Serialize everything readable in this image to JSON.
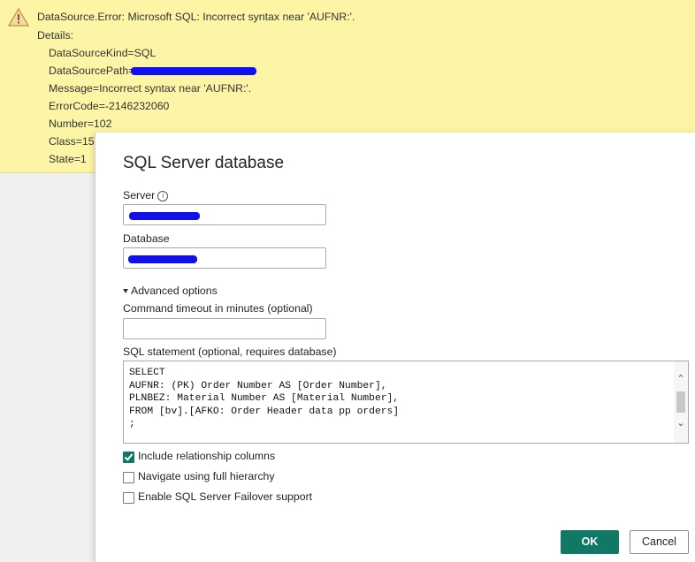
{
  "error": {
    "title": "DataSource.Error: Microsoft SQL: Incorrect syntax near 'AUFNR:'.",
    "details_label": "Details:",
    "source_kind": "DataSourceKind=SQL",
    "source_path_label": "DataSourcePath=",
    "message": "Message=Incorrect syntax near 'AUFNR:'.",
    "error_code": "ErrorCode=-2146232060",
    "number": "Number=102",
    "class": "Class=15",
    "state": "State=1",
    "warning_color": "#e8a33d"
  },
  "dialog": {
    "title": "SQL Server database",
    "server_label": "Server",
    "database_label": "Database",
    "advanced_label": "Advanced options",
    "timeout_label": "Command timeout in minutes (optional)",
    "timeout_value": "",
    "sql_label": "SQL statement (optional, requires database)",
    "sql_lines": [
      "SELECT",
      "AUFNR: (PK) Order Number AS [Order Number],",
      "PLNBEZ: Material Number AS [Material Number],",
      "FROM [bv].[AFKO: Order Header data pp orders]",
      ";"
    ],
    "checkboxes": [
      {
        "label": "Include relationship columns",
        "checked": true
      },
      {
        "label": "Navigate using full hierarchy",
        "checked": false
      },
      {
        "label": "Enable SQL Server Failover support",
        "checked": false
      }
    ],
    "ok_label": "OK",
    "cancel_label": "Cancel",
    "accent_color": "#117865"
  }
}
